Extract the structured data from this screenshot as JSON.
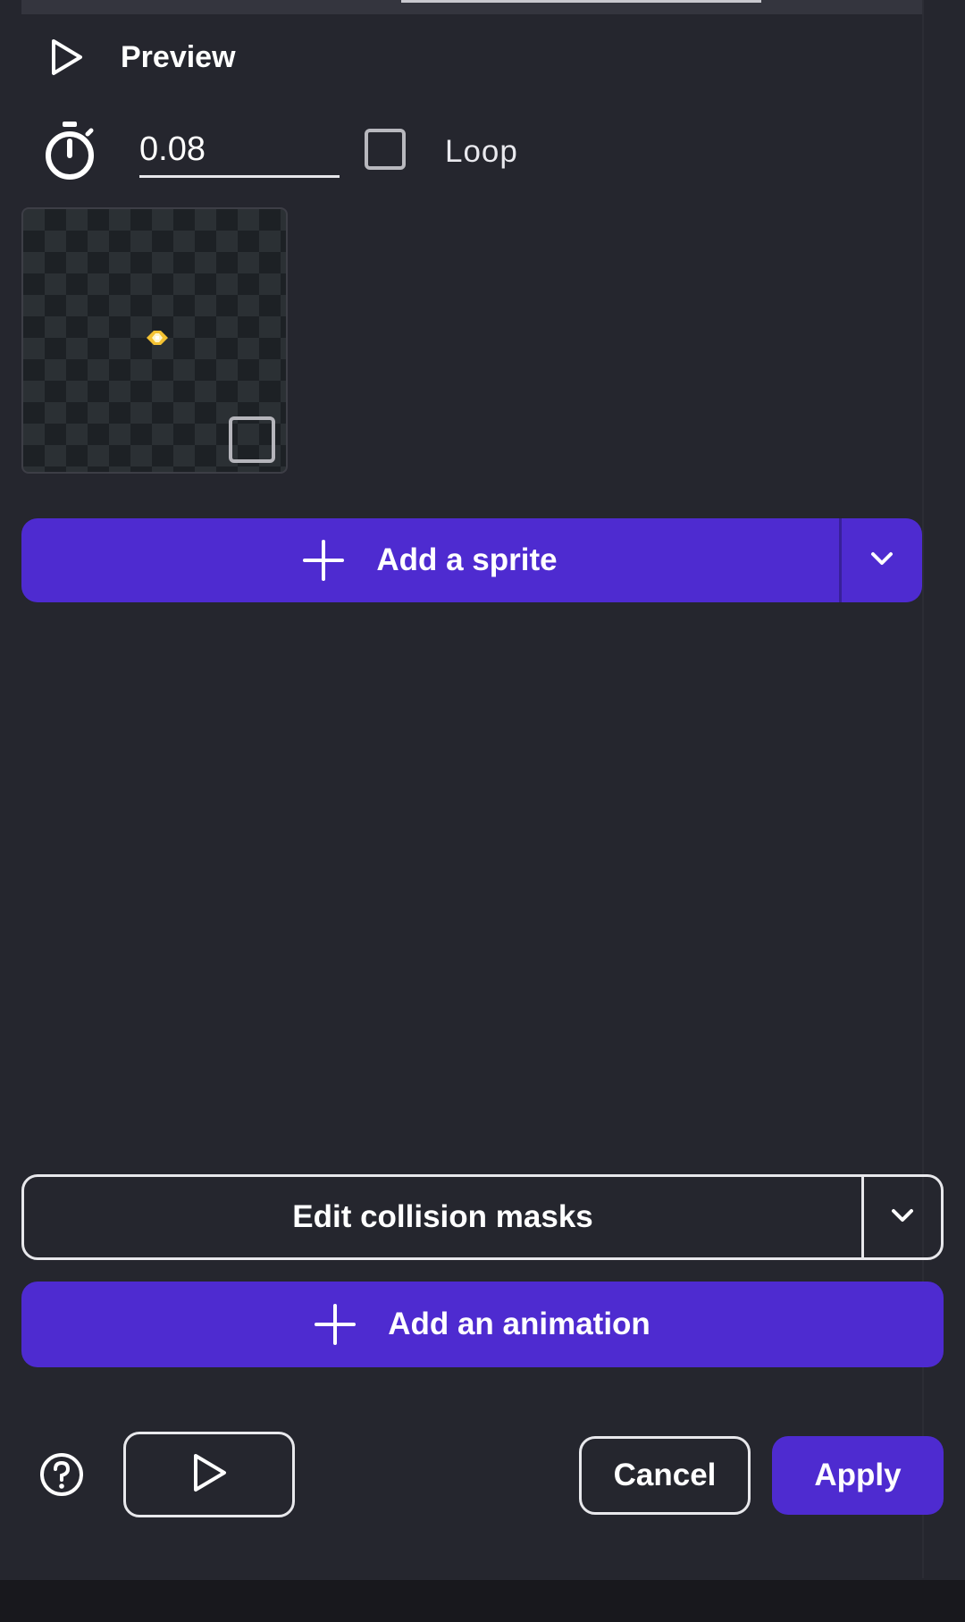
{
  "preview": {
    "label": "Preview",
    "icon": "play-outline-icon"
  },
  "animation_settings": {
    "timer_icon": "stopwatch-icon",
    "frame_duration": "0.08",
    "loop_label": "Loop",
    "loop_checked": false
  },
  "sprites": [
    {
      "icon": "gem-sprite",
      "selected": false
    }
  ],
  "add_sprite": {
    "label": "Add a sprite",
    "icon": "plus-icon",
    "menu_icon": "chevron-down-icon"
  },
  "edit_masks": {
    "label": "Edit collision masks",
    "menu_icon": "chevron-down-icon"
  },
  "add_animation": {
    "label": "Add an animation",
    "icon": "plus-icon"
  },
  "footer": {
    "help_icon": "help-circle-icon",
    "play_icon": "play-outline-icon",
    "cancel_label": "Cancel",
    "apply_label": "Apply"
  },
  "colors": {
    "background": "#25262e",
    "primary": "#4e2bd0",
    "text": "#ffffff",
    "outline": "#e8e8ec"
  }
}
